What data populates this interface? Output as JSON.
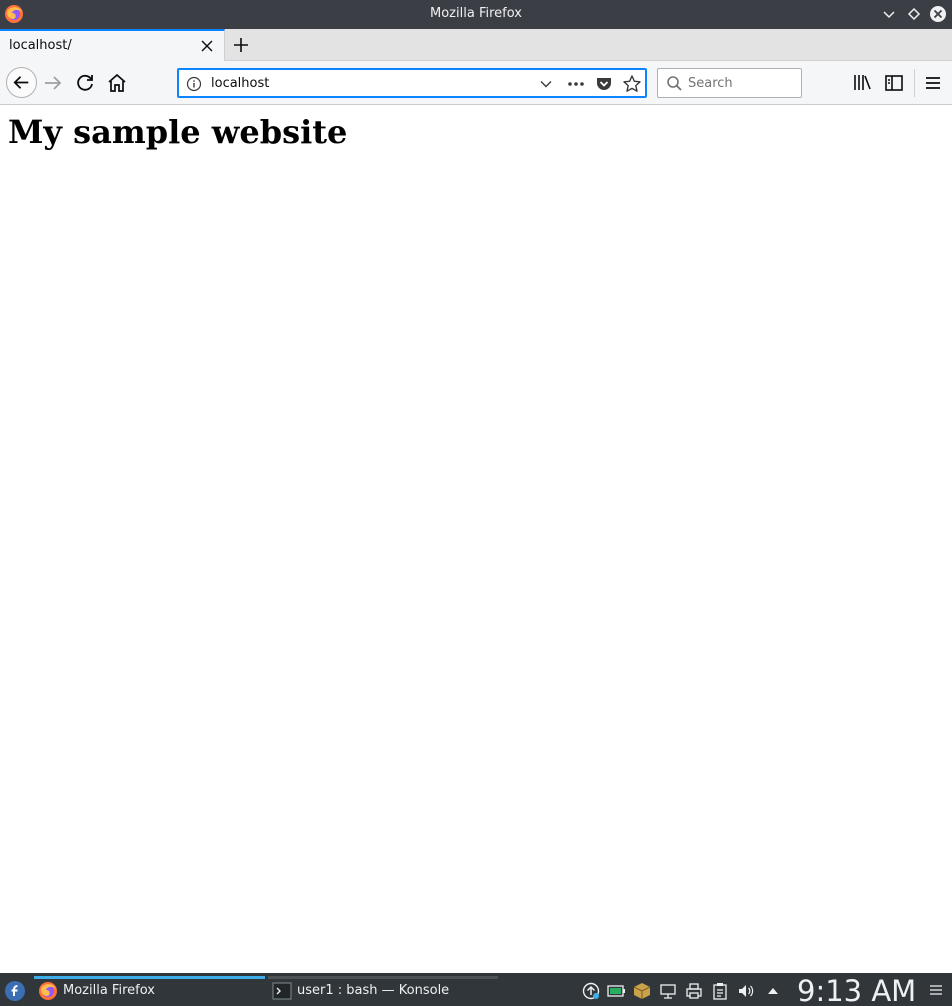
{
  "window": {
    "title": "Mozilla Firefox"
  },
  "tabs": [
    {
      "label": "localhost/",
      "active": true
    }
  ],
  "navbar": {
    "url": "localhost",
    "search_placeholder": "Search"
  },
  "page": {
    "heading": "My sample website"
  },
  "taskbar": {
    "tasks": [
      {
        "label": "Mozilla Firefox",
        "active": true
      },
      {
        "label": "user1 : bash — Konsole",
        "active": false
      }
    ],
    "clock": "9:13 AM"
  },
  "colors": {
    "accent": "#0a84ff",
    "titlebar": "#3b3f45",
    "taskbar": "#31363b",
    "task_active": "#3daee9"
  }
}
